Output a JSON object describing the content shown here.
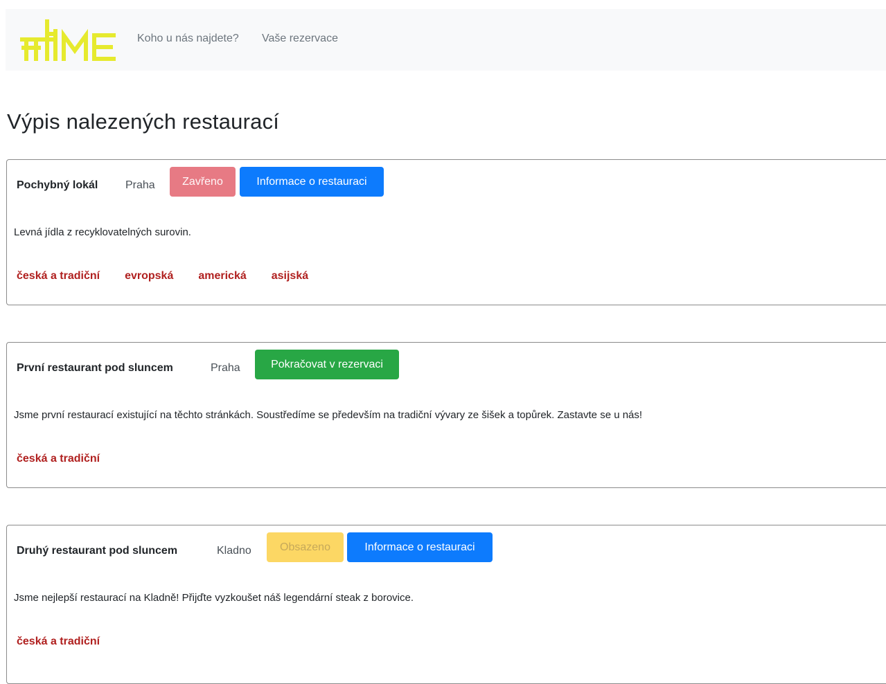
{
  "navbar": {
    "logo_alt": "HOME",
    "links": [
      "Koho u nás najdete?",
      "Vaše rezervace"
    ]
  },
  "page": {
    "title": "Výpis nalezených restaurací"
  },
  "restaurants": [
    {
      "name": "Pochybný lokál",
      "city": "Praha",
      "buttons": [
        "Zavřeno",
        "Informace o restauraci"
      ],
      "description": "Levná jídla z recyklovatelných surovin.",
      "tags": [
        "česká a tradiční",
        "evropská",
        "americká",
        "asijská"
      ]
    },
    {
      "name": "První restaurant pod sluncem",
      "city": "Praha",
      "buttons": [
        "Pokračovat v rezervaci"
      ],
      "description": "Jsme první restaurací existující na těchto stránkách. Soustředíme se především na tradiční vývary ze šišek a topůrek. Zastavte se u nás!",
      "tags": [
        "česká a tradiční"
      ]
    },
    {
      "name": "Druhý restaurant pod sluncem",
      "city": "Kladno",
      "buttons": [
        "Obsazeno",
        "Informace o restauraci"
      ],
      "description": "Jsme nejlepší restaurací na Kladně! Přijďte vyzkoušet náš legendární steak z borovice.",
      "tags": [
        "česká a tradiční"
      ]
    }
  ],
  "colors": {
    "logo": "#e6ea2e",
    "navbar_bg": "#f8f9fa",
    "danger": "#e77a84",
    "primary": "#0d7bfd",
    "success": "#28a745",
    "warning": "#fcd764",
    "tag": "#b0201f"
  }
}
